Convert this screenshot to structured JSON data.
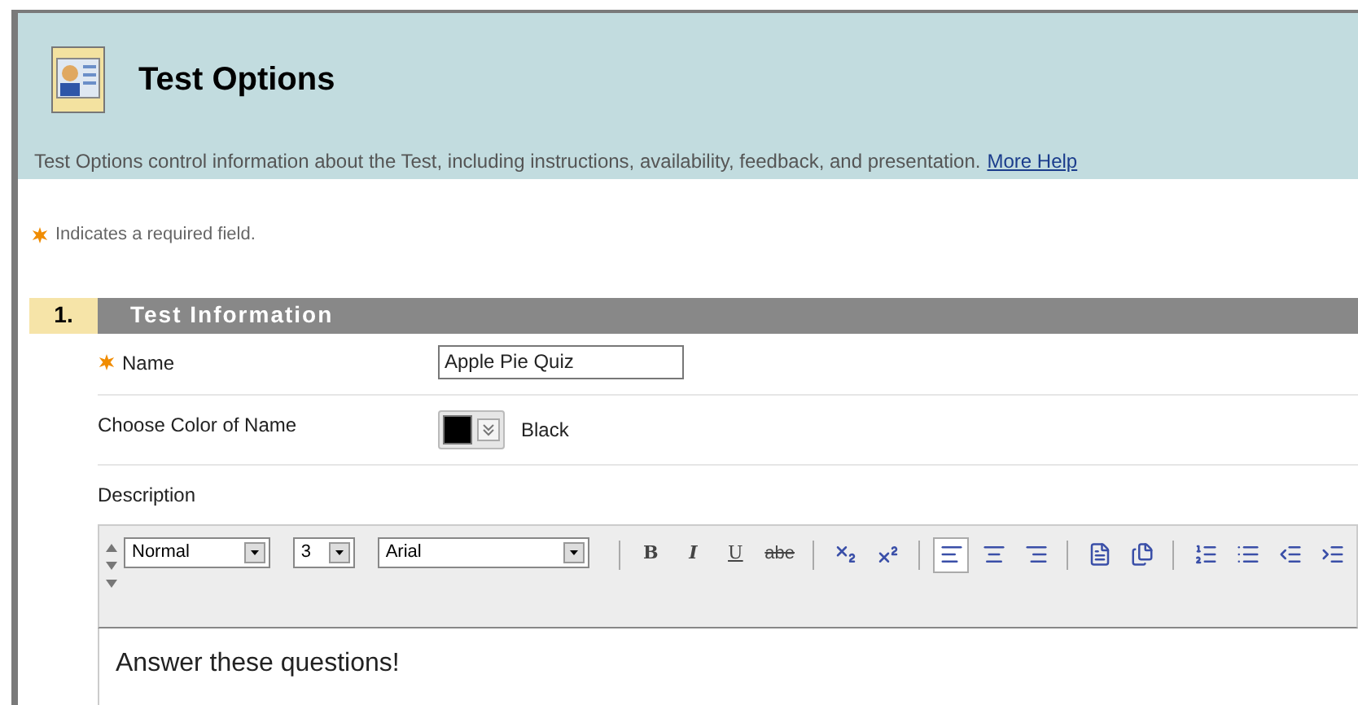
{
  "header": {
    "title": "Test Options",
    "description": "Test Options control information about the Test, including instructions, availability, feedback, and presentation.",
    "help_link": "More Help"
  },
  "required_note": "Indicates a required field.",
  "section": {
    "number": "1.",
    "title": "Test Information"
  },
  "fields": [
    {
      "kind": "text",
      "label": "Name",
      "required": true,
      "value": "Apple Pie Quiz"
    },
    {
      "kind": "color",
      "label": "Choose Color of Name",
      "required": false,
      "color": "#000000",
      "value": "Black"
    },
    {
      "kind": "heading",
      "label": "Description",
      "required": false
    }
  ],
  "editor": {
    "selects": [
      {
        "value": "Normal",
        "kind": "wide"
      },
      {
        "value": "3",
        "kind": "narrow"
      },
      {
        "value": "Arial",
        "kind": "wider"
      }
    ],
    "buttons": [
      {
        "kind": "bold",
        "label": "B",
        "selected": false
      },
      {
        "kind": "italic",
        "label": "I",
        "selected": false
      },
      {
        "kind": "underline",
        "label": "U",
        "selected": false
      },
      {
        "kind": "strike",
        "label": "abe",
        "selected": false
      },
      {
        "kind": "subscript",
        "selected": false
      },
      {
        "kind": "superscript",
        "selected": false
      },
      {
        "kind": "align-left",
        "selected": true
      },
      {
        "kind": "align-center",
        "selected": false
      },
      {
        "kind": "align-right",
        "selected": false
      },
      {
        "kind": "page-out",
        "selected": false
      },
      {
        "kind": "page-in",
        "selected": false
      },
      {
        "kind": "ordered-list",
        "selected": false
      },
      {
        "kind": "bullet-list",
        "selected": false
      },
      {
        "kind": "outdent",
        "selected": false
      },
      {
        "kind": "indent",
        "selected": false
      }
    ],
    "content": "Answer these questions!"
  }
}
